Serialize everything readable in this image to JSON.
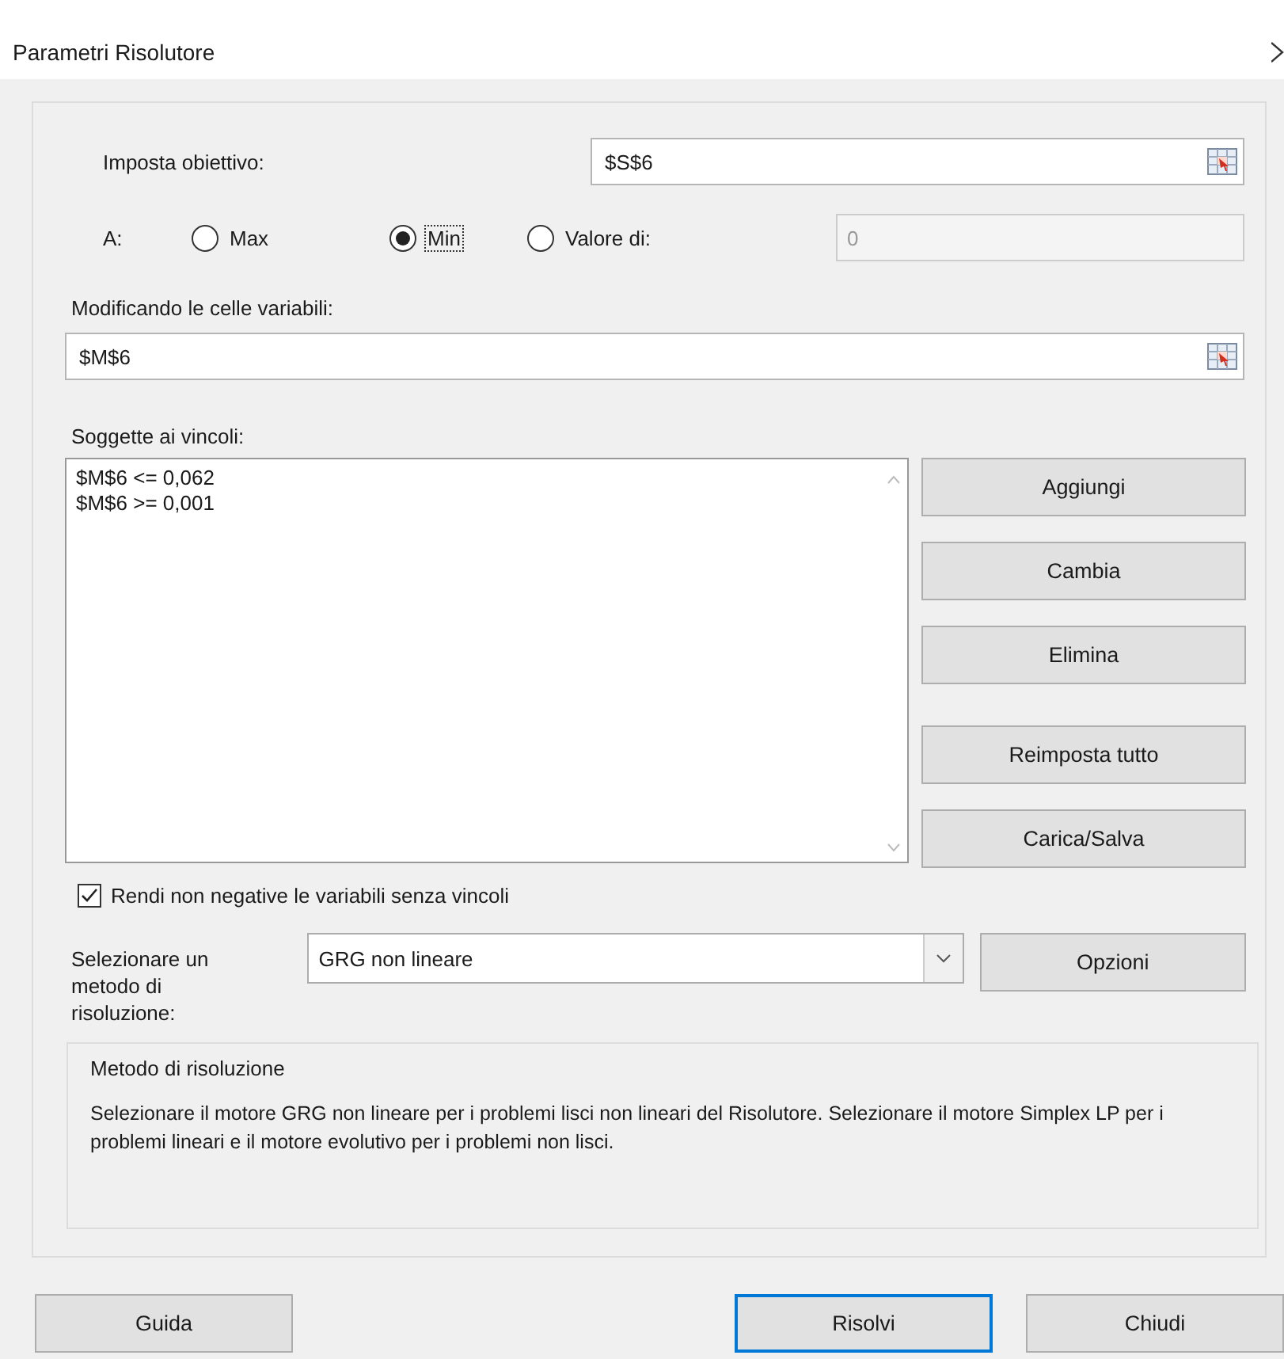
{
  "window": {
    "title": "Parametri Risolutore"
  },
  "objective": {
    "label": "Imposta obiettivo:",
    "value": "$S$6"
  },
  "to": {
    "label": "A:",
    "target_disabled": true,
    "target_value": "0",
    "options": [
      {
        "label": "Max",
        "selected": false,
        "focused": false
      },
      {
        "label": "Min",
        "selected": true,
        "focused": true
      },
      {
        "label": "Valore di:",
        "selected": false,
        "focused": false
      }
    ]
  },
  "variables": {
    "label": "Modificando le celle variabili:",
    "value": "$M$6"
  },
  "constraints": {
    "label": "Soggette ai vincoli:",
    "items": [
      "$M$6 <= 0,062",
      "$M$6 >= 0,001"
    ]
  },
  "constraint_buttons": [
    "Aggiungi",
    "Cambia",
    "Elimina",
    "Reimposta tutto",
    "Carica/Salva"
  ],
  "nonnegative": {
    "label": "Rendi non negative le variabili senza vincoli",
    "checked": true
  },
  "method": {
    "label": "Selezionare un metodo di risoluzione:",
    "value": "GRG non lineare",
    "options_button": "Opzioni"
  },
  "description": {
    "title": "Metodo di risoluzione",
    "text": "Selezionare il motore GRG non lineare per i problemi lisci non lineari del Risolutore. Selezionare il motore Simplex LP per i problemi lineari e il motore evolutivo per i problemi non lisci."
  },
  "footer_buttons": [
    {
      "label": "Guida",
      "focused": false
    },
    {
      "label": "Risolvi",
      "focused": true
    },
    {
      "label": "Chiudi",
      "focused": false
    }
  ]
}
